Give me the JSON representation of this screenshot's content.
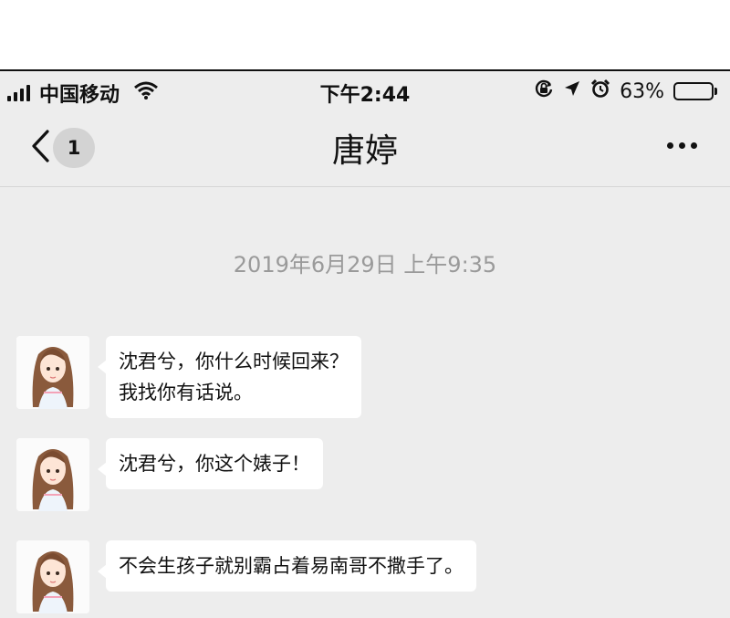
{
  "status_bar": {
    "carrier": "中国移动",
    "time": "下午2:44",
    "battery_percent": "63%",
    "battery_level": 0.63,
    "icons": [
      "signal-icon",
      "wifi-icon",
      "orientation-lock-icon",
      "location-icon",
      "alarm-icon",
      "battery-icon"
    ]
  },
  "nav": {
    "back_icon": "chevron-left-icon",
    "unread_count": "1",
    "title": "唐婷",
    "more_icon": "more-dots-icon"
  },
  "chat": {
    "timestamp": "2019年6月29日 上午9:35",
    "messages": [
      {
        "sender": "avatar",
        "lines": [
          "沈君兮，你什么时候回来？",
          "我找你有话说。"
        ]
      },
      {
        "sender": "avatar",
        "lines": [
          "沈君兮，你这个婊子！"
        ]
      },
      {
        "sender": "avatar",
        "lines": [
          "不会生孩子就别霸占着易南哥不撒手了。"
        ]
      }
    ]
  },
  "colors": {
    "background": "#ededed",
    "bubble": "#ffffff",
    "timestamp_text": "#9a9a9a",
    "badge": "#d3d3d3"
  }
}
